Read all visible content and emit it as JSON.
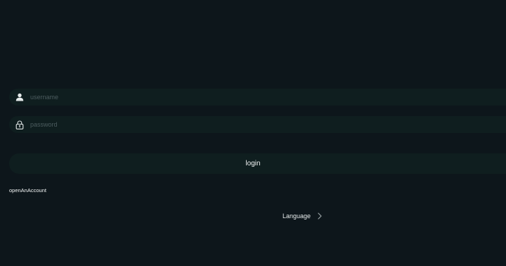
{
  "form": {
    "username": {
      "placeholder": "username",
      "value": "",
      "icon": "user-icon"
    },
    "password": {
      "placeholder": "password",
      "value": "",
      "icon": "lock-icon"
    },
    "login_label": "login",
    "open_account_label": "openAnAccount"
  },
  "language": {
    "label": "Language",
    "icon": "chevron-right-icon"
  },
  "colors": {
    "background": "#0d161b",
    "field_background": "#0f1e1f",
    "text": "#f2f5f5",
    "placeholder": "#4c5c5f"
  }
}
